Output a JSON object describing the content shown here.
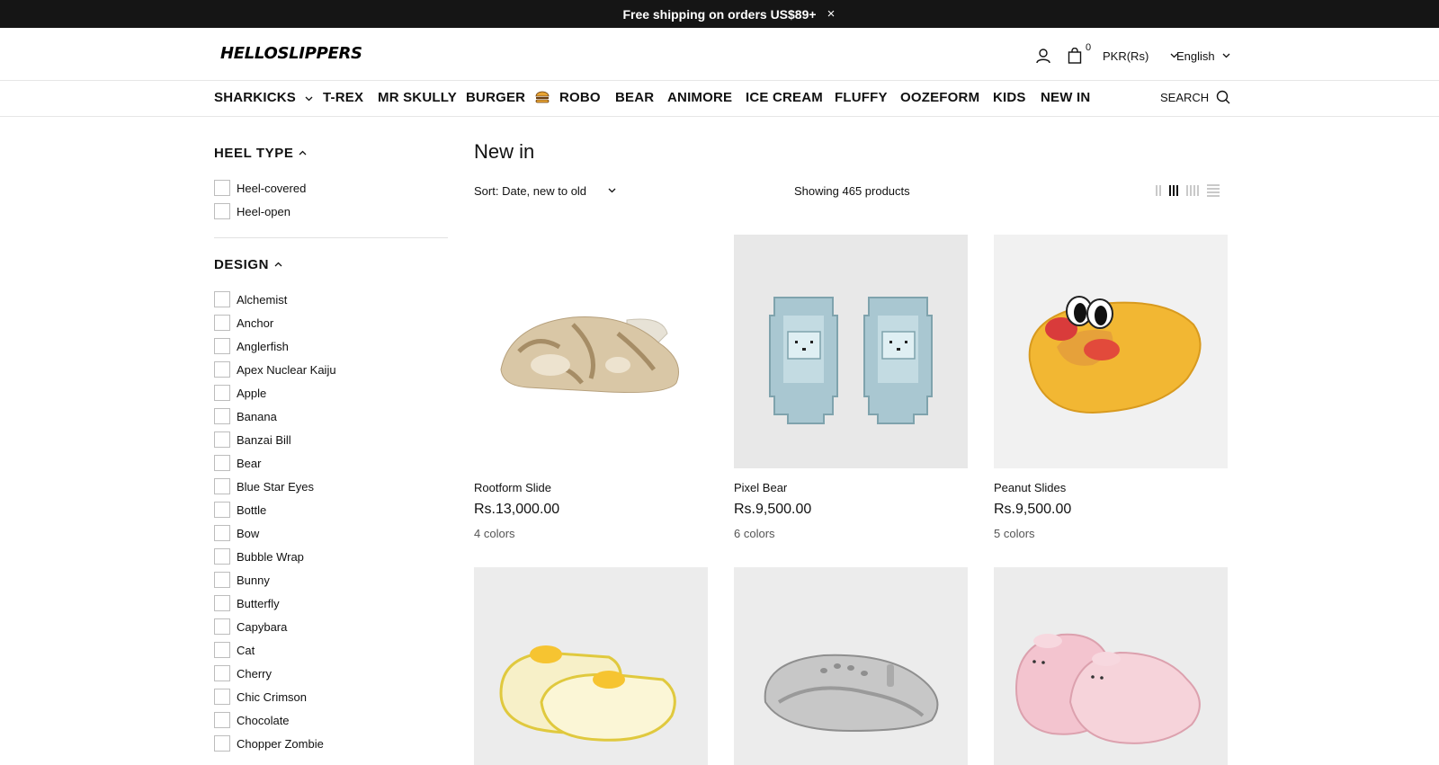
{
  "announcement": {
    "text": "Free shipping on orders US$89+",
    "close": "×"
  },
  "header": {
    "logo": "HELLOSLIPPERS",
    "cart_count": "0",
    "currency": "PKR(Rs)",
    "language": "English",
    "icons": {
      "account": "user-icon",
      "cart": "shopping-bag-icon"
    }
  },
  "nav": {
    "items": [
      "SHARKICKS",
      "T-REX",
      "MR SKULLY",
      "BURGER",
      "ROBO",
      "BEAR",
      "ANIMORE",
      "ICE CREAM",
      "FLUFFY",
      "OOZEFORM",
      "KIDS",
      "NEW IN"
    ],
    "search_label": "SEARCH"
  },
  "filters": {
    "heel_type": {
      "title": "HEEL TYPE",
      "options": [
        "Heel-covered",
        "Heel-open"
      ]
    },
    "design": {
      "title": "DESIGN",
      "options": [
        "Alchemist",
        "Anchor",
        "Anglerfish",
        "Apex Nuclear Kaiju",
        "Apple",
        "Banana",
        "Banzai Bill",
        "Bear",
        "Blue Star Eyes",
        "Bottle",
        "Bow",
        "Bubble Wrap",
        "Bunny",
        "Butterfly",
        "Capybara",
        "Cat",
        "Cherry",
        "Chic Crimson",
        "Chocolate",
        "Chopper Zombie"
      ]
    }
  },
  "main": {
    "title": "New in",
    "sort_label": "Sort:",
    "sort_value": "Date, new to old",
    "showing": "Showing 465 products"
  },
  "products": [
    {
      "name": "Rootform Slide",
      "price": "Rs.13,000.00",
      "colors": "4 colors",
      "color": "#d9c7a6"
    },
    {
      "name": "Pixel Bear",
      "price": "Rs.9,500.00",
      "colors": "6 colors",
      "color": "#a9c7d1"
    },
    {
      "name": "Peanut Slides",
      "price": "Rs.9,500.00",
      "colors": "5 colors",
      "color": "#f2b733"
    },
    {
      "name": "",
      "price": "",
      "colors": "",
      "color": "#f7f0c8"
    },
    {
      "name": "",
      "price": "",
      "colors": "",
      "color": "#c7c7c7"
    },
    {
      "name": "",
      "price": "",
      "colors": "",
      "color": "#f3c4cf"
    }
  ]
}
